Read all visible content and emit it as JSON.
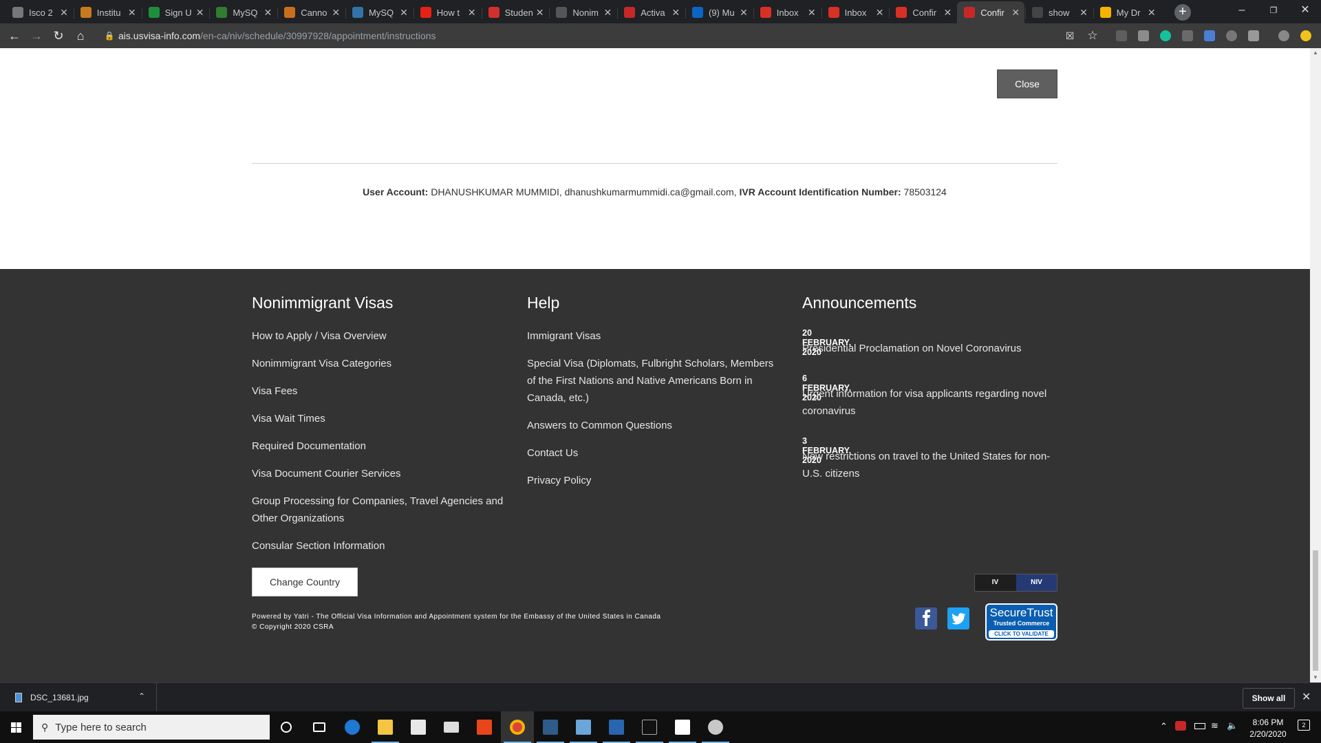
{
  "browser": {
    "tabs": [
      {
        "title": "Isco 2",
        "favicon": "#777"
      },
      {
        "title": "Institu",
        "favicon": "#c77b1e"
      },
      {
        "title": "Sign U",
        "favicon": "#1e8e3e"
      },
      {
        "title": "MySQ",
        "favicon": "#2e7d32"
      },
      {
        "title": "Canno",
        "favicon": "#c86f1e"
      },
      {
        "title": "MySQ",
        "favicon": "#3273a8"
      },
      {
        "title": "How t",
        "favicon": "#e62117"
      },
      {
        "title": "Studen",
        "favicon": "#d32f2f"
      },
      {
        "title": "Nonim",
        "favicon": "#555"
      },
      {
        "title": "Activa",
        "favicon": "#c62828"
      },
      {
        "title": "(9) Mu",
        "favicon": "#0a66c2"
      },
      {
        "title": "Inbox",
        "favicon": "#d93025"
      },
      {
        "title": "Inbox",
        "favicon": "#d93025"
      },
      {
        "title": "Confir",
        "favicon": "#d93025"
      },
      {
        "title": "Confir",
        "favicon": "#c62828"
      },
      {
        "title": "show",
        "favicon": "#444"
      },
      {
        "title": "My Dr",
        "favicon": "#f4b400"
      }
    ],
    "active_tab_index": 14,
    "url_host": "ais.usvisa-info.com",
    "url_path": "/en-ca/niv/schedule/30997928/appointment/instructions"
  },
  "page": {
    "close_label": "Close",
    "account": {
      "user_label": "User Account:",
      "user_value": "DHANUSHKUMAR MUMMIDI, dhanushkumarmummidi.ca@gmail.com,",
      "ivr_label": "IVR Account Identification Number:",
      "ivr_value": "78503124"
    }
  },
  "footer": {
    "nonimmigrant": {
      "heading": "Nonimmigrant Visas",
      "links": [
        "How to Apply / Visa Overview",
        "Nonimmigrant Visa Categories",
        "Visa Fees",
        "Visa Wait Times",
        "Required Documentation",
        "Visa Document Courier Services",
        "Group Processing for Companies, Travel Agencies and Other Organizations",
        "Consular Section Information"
      ]
    },
    "help": {
      "heading": "Help",
      "links": [
        "Immigrant Visas",
        "Special Visa (Diplomats, Fulbright Scholars, Members of the First Nations and Native Americans Born in Canada, etc.)",
        "Answers to Common Questions",
        "Contact Us",
        "Privacy Policy"
      ]
    },
    "announcements": {
      "heading": "Announcements",
      "items": [
        {
          "date": "20 FEBRUARY, 2020",
          "text": "Presidential Proclamation on Novel Coronavirus"
        },
        {
          "date": "6 FEBRUARY, 2020",
          "text": "Urgent information for visa applicants regarding novel coronavirus"
        },
        {
          "date": "3 FEBRUARY, 2020",
          "text": "New restrictions on travel to the United States for non-U.S. citizens"
        }
      ]
    },
    "change_country": "Change Country",
    "powered_by": "Powered by Yatri - The Official Visa Information and Appointment system for the Embassy of the United States in Canada",
    "copyright": "© Copyright 2020 CSRA",
    "toggle": {
      "iv": "IV",
      "niv": "NIV"
    },
    "securetrust": {
      "line1": "SecureTrust",
      "line2": "Trusted Commerce",
      "line3": "CLICK TO VALIDATE"
    }
  },
  "downloads": {
    "file_name": "DSC_13681.jpg",
    "show_all": "Show all"
  },
  "taskbar": {
    "search_placeholder": "Type here to search",
    "time": "8:06 PM",
    "date": "2/20/2020",
    "notification_count": "2"
  },
  "colors": {
    "footer_bg": "#333333",
    "close_button": "#5f5f5f",
    "niv_active": "#253a75"
  }
}
